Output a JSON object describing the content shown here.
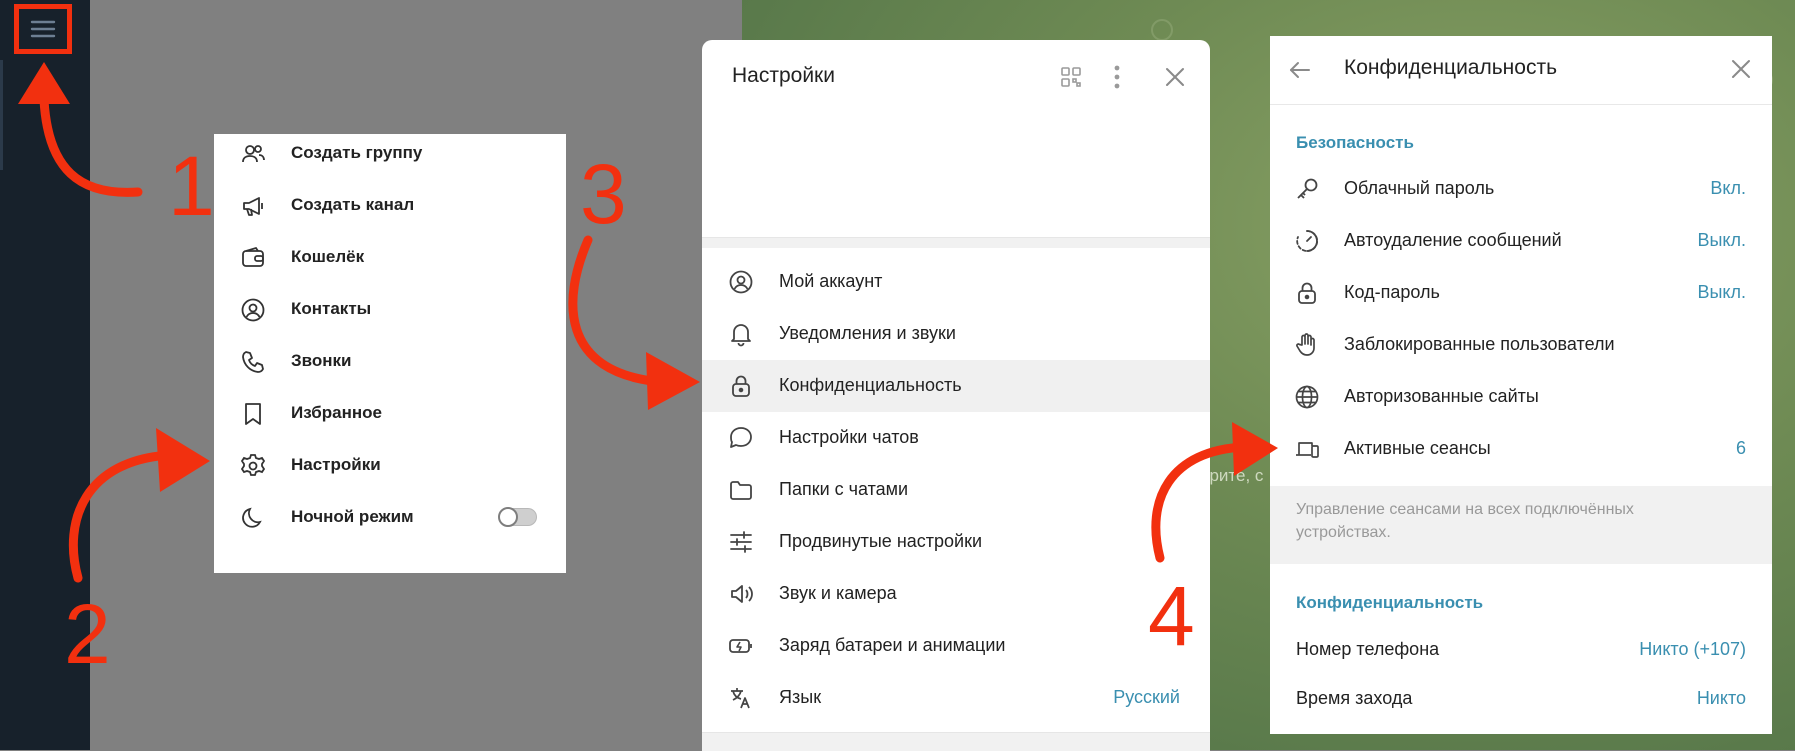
{
  "menu": {
    "items": [
      {
        "label": "Создать группу",
        "icon": "group-icon"
      },
      {
        "label": "Создать канал",
        "icon": "megaphone-icon"
      },
      {
        "label": "Кошелёк",
        "icon": "wallet-icon"
      },
      {
        "label": "Контакты",
        "icon": "contacts-icon"
      },
      {
        "label": "Звонки",
        "icon": "phone-icon"
      },
      {
        "label": "Избранное",
        "icon": "bookmark-icon"
      },
      {
        "label": "Настройки",
        "icon": "gear-icon"
      },
      {
        "label": "Ночной режим",
        "icon": "moon-icon",
        "toggle": false
      }
    ]
  },
  "settings": {
    "title": "Настройки",
    "items": [
      {
        "label": "Мой аккаунт",
        "icon": "account-icon"
      },
      {
        "label": "Уведомления и звуки",
        "icon": "bell-icon"
      },
      {
        "label": "Конфиденциальность",
        "icon": "lock-icon",
        "active": true
      },
      {
        "label": "Настройки чатов",
        "icon": "chat-bubble-icon"
      },
      {
        "label": "Папки с чатами",
        "icon": "folder-icon"
      },
      {
        "label": "Продвинутые настройки",
        "icon": "sliders-icon"
      },
      {
        "label": "Звук и камера",
        "icon": "speaker-icon"
      },
      {
        "label": "Заряд батареи и анимации",
        "icon": "battery-icon"
      },
      {
        "label": "Язык",
        "icon": "translate-icon",
        "value": "Русский"
      }
    ]
  },
  "privacy": {
    "title": "Конфиденциальность",
    "security_section": "Безопасность",
    "security_items": [
      {
        "label": "Облачный пароль",
        "icon": "key-icon",
        "value": "Вкл."
      },
      {
        "label": "Автоудаление сообщений",
        "icon": "timer-icon",
        "value": "Выкл."
      },
      {
        "label": "Код-пароль",
        "icon": "lock-icon",
        "value": "Выкл."
      },
      {
        "label": "Заблокированные пользователи",
        "icon": "hand-icon",
        "value": ""
      },
      {
        "label": "Авторизованные сайты",
        "icon": "globe-icon",
        "value": ""
      },
      {
        "label": "Активные сеансы",
        "icon": "devices-icon",
        "value": "6"
      }
    ],
    "sessions_hint": "Управление сеансами на всех подключённых устройствах.",
    "privacy_section": "Конфиденциальность",
    "privacy_items": [
      {
        "label": "Номер телефона",
        "value": "Никто (+107)"
      },
      {
        "label": "Время захода",
        "value": "Никто"
      }
    ]
  },
  "background_text": "ерите, с",
  "annotations": {
    "step1": "1",
    "step2": "2",
    "step3": "3",
    "step4": "4"
  },
  "colors": {
    "annotation": "#f2300f",
    "accent": "#3a8fb0",
    "sidebar": "#17212b"
  }
}
